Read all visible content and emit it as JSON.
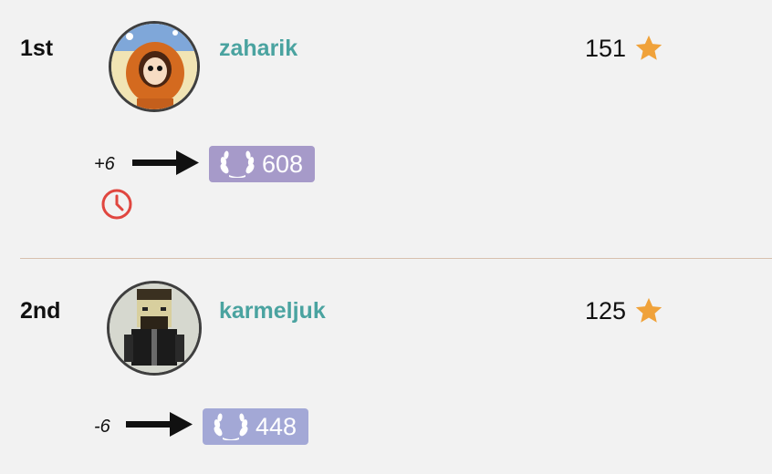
{
  "leaderboard": {
    "entries": [
      {
        "rank": "1st",
        "username": "zaharik",
        "score": "151",
        "rating_change": "+6",
        "rating": "608",
        "badge_color": "#a69ac9",
        "avatar_description": "orange-hooded-character",
        "has_clock": true
      },
      {
        "rank": "2nd",
        "username": "karmeljuk",
        "score": "125",
        "rating_change": "-6",
        "rating": "448",
        "badge_color": "#a3a8d6",
        "avatar_description": "pixel-bearded-character",
        "has_clock": false
      }
    ]
  },
  "colors": {
    "username": "#4aa3a0",
    "star": "#f0a23a",
    "clock": "#e0463f",
    "divider": "#d7c0ae"
  },
  "icons": {
    "score": "star-icon",
    "rating": "laurel-icon",
    "change": "arrow-right-icon",
    "timer": "clock-icon"
  }
}
